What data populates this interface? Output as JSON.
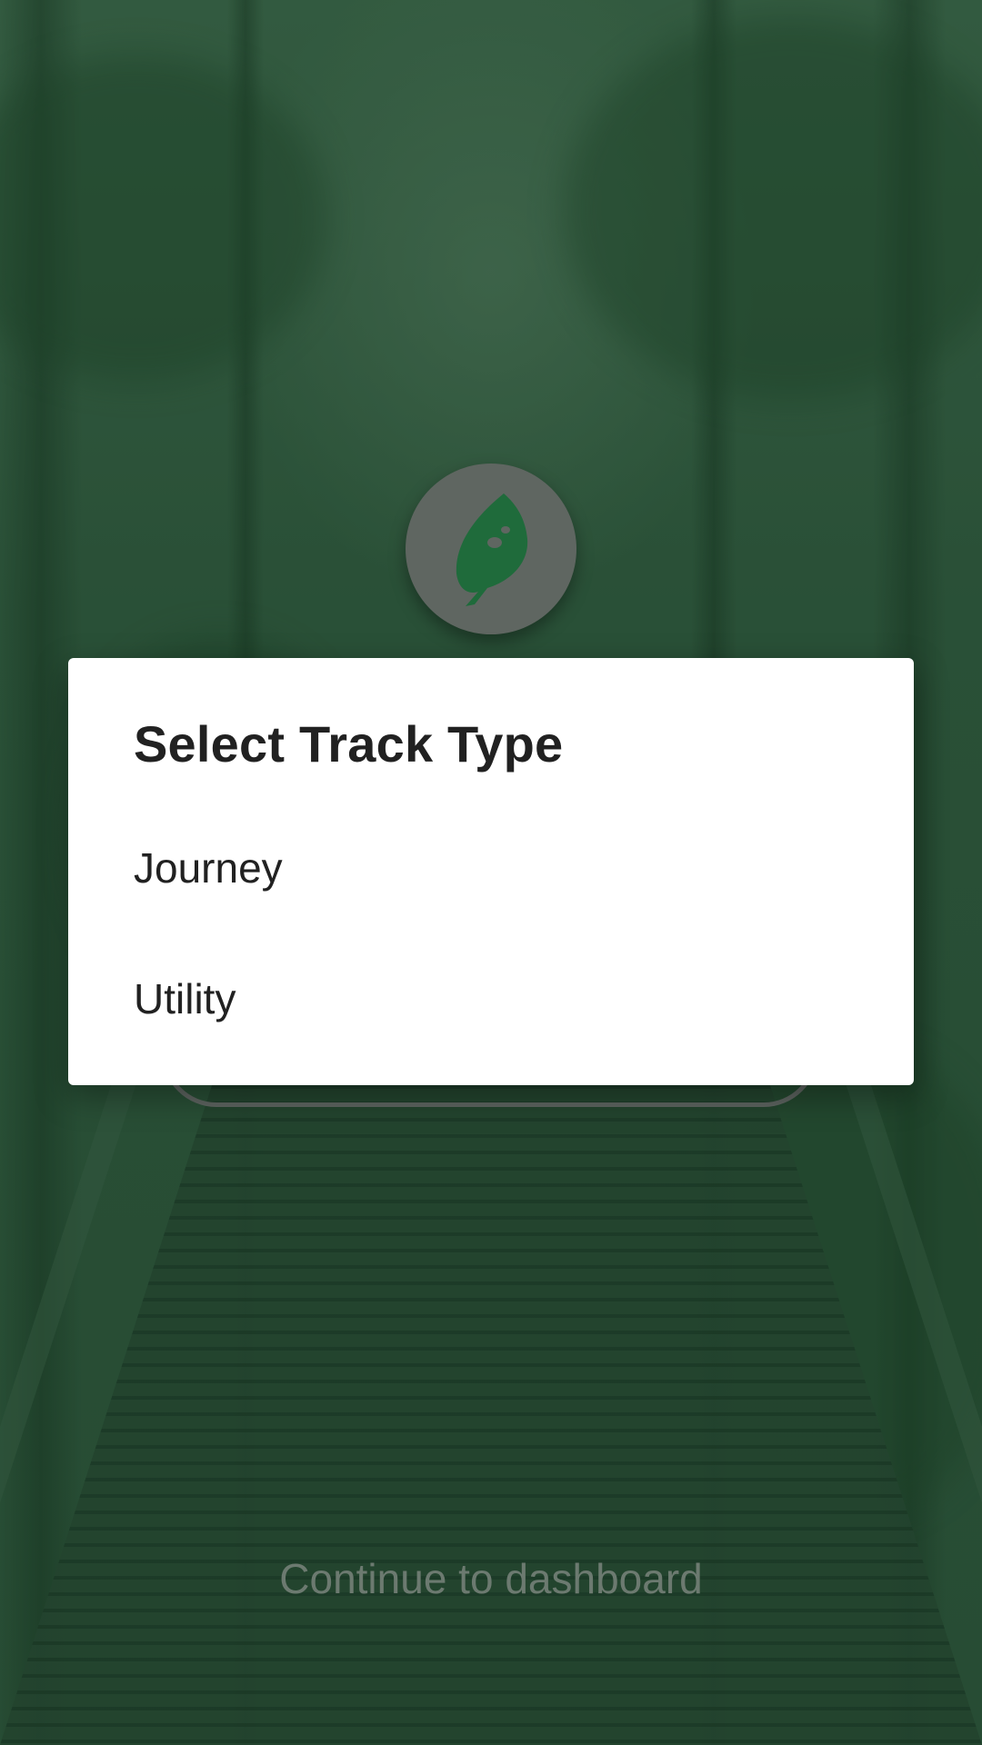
{
  "dialog": {
    "title": "Select Track Type",
    "options": [
      {
        "label": "Journey"
      },
      {
        "label": "Utility"
      }
    ]
  },
  "footer": {
    "continue_label": "Continue to dashboard"
  },
  "logo": {
    "icon": "leaf-icon",
    "background_color": "#5f6661",
    "icon_color": "#1f6b3b"
  },
  "colors": {
    "scrim_green": "#2f5a3e",
    "dialog_bg": "#ffffff",
    "text_primary": "#212121",
    "text_muted": "#6c7a70"
  }
}
